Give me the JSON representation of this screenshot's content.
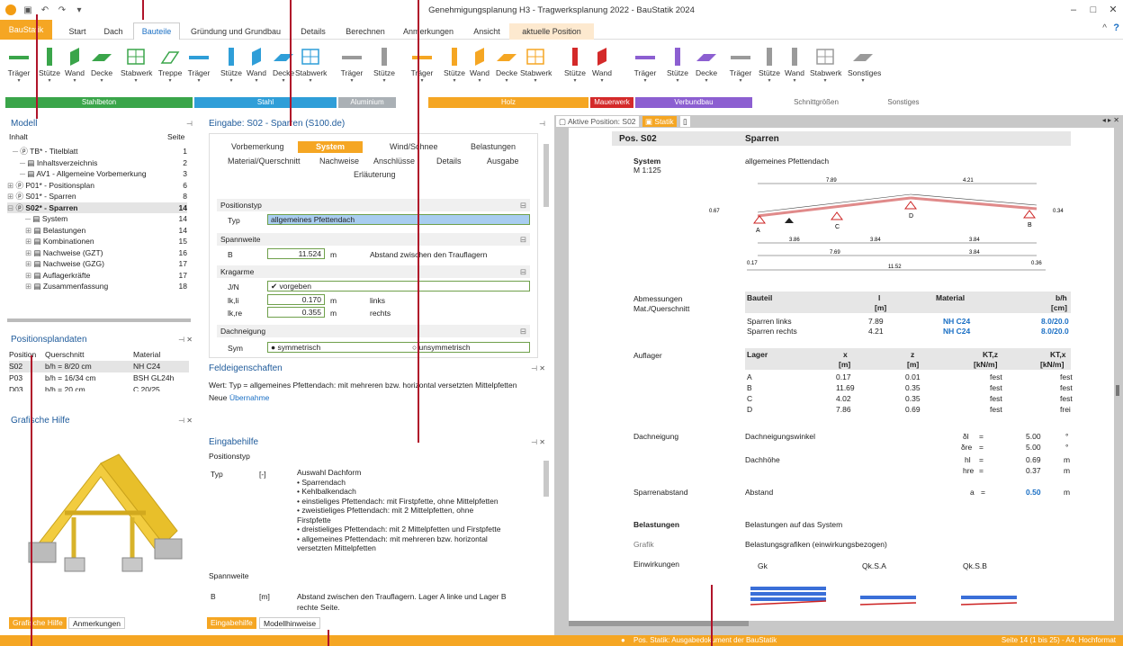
{
  "window": {
    "title": "Genehmigungsplanung H3 - Tragwerksplanung 2022 - BauStatik 2024"
  },
  "tabs": [
    {
      "label": "BauStatik"
    },
    {
      "label": "Start"
    },
    {
      "label": "Dach"
    },
    {
      "label": "Bauteile"
    },
    {
      "label": "Gründung und Grundbau"
    },
    {
      "label": "Details"
    },
    {
      "label": "Berechnen"
    },
    {
      "label": "Anmerkungen"
    },
    {
      "label": "Ansicht"
    },
    {
      "label": "aktuelle Position"
    }
  ],
  "ribbon": {
    "labels": [
      "Träger",
      "Stütze",
      "Wand",
      "Decke",
      "Stabwerk",
      "Treppe",
      "Träger",
      "Stütze",
      "Wand",
      "Decke",
      "Stabwerk",
      "Träger",
      "Stütze",
      "Träger",
      "Stütze",
      "Wand",
      "Decke",
      "Stabwerk",
      "Stütze",
      "Wand",
      "Träger",
      "Stütze",
      "Decke",
      "Träger",
      "Stütze",
      "Wand",
      "Stabwerk",
      "Sonstiges"
    ],
    "groups": [
      "Stahlbeton",
      "Stahl",
      "Aluminium",
      "Holz",
      "Mauerwerk",
      "Verbundbau",
      "Schnittgrößen",
      "Sonstiges"
    ]
  },
  "modell": {
    "title": "Modell",
    "col_content": "Inhalt",
    "col_page": "Seite",
    "items": [
      {
        "label": "TB* - Titelblatt",
        "page": "1"
      },
      {
        "label": "Inhaltsverzeichnis",
        "page": "2"
      },
      {
        "label": "AV1 - Allgemeine Vorbemerkung",
        "page": "3"
      },
      {
        "label": "P01* - Positionsplan",
        "page": "6"
      },
      {
        "label": "S01* - Sparren",
        "page": "8"
      },
      {
        "label": "S02* - Sparren",
        "page": "14"
      },
      {
        "label": "System",
        "page": "14"
      },
      {
        "label": "Belastungen",
        "page": "14"
      },
      {
        "label": "Kombinationen",
        "page": "15"
      },
      {
        "label": "Nachweise (GZT)",
        "page": "16"
      },
      {
        "label": "Nachweise (GZG)",
        "page": "17"
      },
      {
        "label": "Auflagerkräfte",
        "page": "17"
      },
      {
        "label": "Zusammenfassung",
        "page": "18"
      }
    ]
  },
  "positionsplan": {
    "title": "Positionsplandaten",
    "headers": [
      "Position",
      "Querschnitt",
      "Material"
    ],
    "rows": [
      [
        "S02",
        "b/h = 8/20 cm",
        "NH C24"
      ],
      [
        "P03",
        "b/h = 16/34 cm",
        "BSH GL24h"
      ],
      [
        "D03",
        "b/h = 20 cm",
        "C 20/25"
      ]
    ]
  },
  "grafische_hilfe": {
    "title": "Grafische Hilfe",
    "tab1": "Grafische Hilfe",
    "tab2": "Anmerkungen"
  },
  "eingabe": {
    "title": "Eingabe: S02 - Sparren (S100.de)",
    "tabs": [
      "Vorbemerkung",
      "System",
      "Wind/Schnee",
      "Belastungen",
      "Material/Querschnitt",
      "Nachweise",
      "Anschlüsse",
      "Details",
      "Ausgabe",
      "Erläuterung"
    ],
    "sec_postyp": "Positionstyp",
    "typ_label": "Typ",
    "typ_value": "allgemeines Pfettendach",
    "sec_spannweite": "Spannweite",
    "b_label": "B",
    "b_value": "11.524",
    "b_unit": "m",
    "b_desc": "Abstand zwischen den Trauflagern",
    "sec_kragarme": "Kragarme",
    "jn_label": "J/N",
    "jn_value": "vorgeben",
    "lkli_label": "lk,li",
    "lkli_value": "0.170",
    "lkli_unit": "m",
    "lkli_desc": "links",
    "lkre_label": "lk,re",
    "lkre_value": "0.355",
    "lkre_unit": "m",
    "lkre_desc": "rechts",
    "sec_dachneigung": "Dachneigung",
    "sym_label": "Sym",
    "sym_opt1": "symmetrisch",
    "sym_opt2": "unsymmetrisch"
  },
  "feld": {
    "title": "Feldeigenschaften",
    "text": "Wert: Typ = allgemeines Pfettendach: mit mehreren bzw. horizontal versetzten Mittelpfetten",
    "neue": "Neue",
    "link": "Übernahme"
  },
  "eingabehilfe": {
    "title": "Eingabehilfe",
    "section": "Positionstyp",
    "typ": "Typ",
    "unit": "[-]",
    "lines": [
      "Auswahl Dachform",
      "• Sparrendach",
      "• Kehlbalkendach",
      "• einstieliges Pfettendach: mit Firstpfette, ohne Mittelpfetten",
      "• zweistieliges Pfettendach: mit 2 Mittelpfetten, ohne",
      "Firstpfette",
      "• dreistieliges Pfettendach: mit 2 Mittelpfetten und Firstpfette",
      "• allgemeines Pfettendach: mit mehreren bzw. horizontal",
      "versetzten Mittelpfetten"
    ],
    "section2": "Spannweite",
    "b": "B",
    "b_unit": "[m]",
    "b_text1": "Abstand zwischen den Trauflagern. Lager A linke und Lager B",
    "b_text2": "rechte Seite.",
    "tab1": "Eingabehilfe",
    "tab2": "Modellhinweise"
  },
  "doc": {
    "tab1": "Aktive Position: S02",
    "tab2": "Statik",
    "pos": "Pos. S02",
    "pos_name": "Sparren",
    "system": "System",
    "scale": "M 1:125",
    "system_val": "allgemeines Pfettendach",
    "dims": [
      "7.89",
      "4.21",
      "3.86",
      "3.84",
      "3.84",
      "7.69",
      "3.84",
      "0.17",
      "11.52",
      "0.36",
      "0.34",
      "0.67"
    ],
    "supports": [
      "A",
      "C",
      "D",
      "B"
    ],
    "abm": "Abmessungen",
    "matq": "Mat./Querschnitt",
    "h_bauteil": "Bauteil",
    "h_l": "l",
    "h_lunit": "[m]",
    "h_mat": "Material",
    "h_bh": "b/h",
    "h_bhunit": "[cm]",
    "rows_mat": [
      [
        "Sparren links",
        "7.89",
        "NH C24",
        "8.0/20.0"
      ],
      [
        "Sparren rechts",
        "4.21",
        "NH C24",
        "8.0/20.0"
      ]
    ],
    "auflager": "Auflager",
    "h_lager": "Lager",
    "h_x": "x",
    "h_z": "z",
    "h_ktz": "KT,z",
    "h_ktx": "KT,x",
    "h_xu": "[m]",
    "h_zu": "[m]",
    "h_ktzu": "[kN/m]",
    "h_ktxu": "[kN/m]",
    "rows_lager": [
      [
        "A",
        "0.17",
        "0.01",
        "fest",
        "fest"
      ],
      [
        "B",
        "11.69",
        "0.35",
        "fest",
        "fest"
      ],
      [
        "C",
        "4.02",
        "0.35",
        "fest",
        "fest"
      ],
      [
        "D",
        "7.86",
        "0.69",
        "fest",
        "frei"
      ]
    ],
    "dachneigung": "Dachneigung",
    "dn_winkel": "Dachneigungswinkel",
    "dl": "δl",
    "dr": "δre",
    "dl_val": "5.00",
    "dr_val": "5.00",
    "deg": "°",
    "dachhoehe": "Dachhöhe",
    "hl": "hl",
    "hr": "hre",
    "hl_val": "0.69",
    "hr_val": "0.37",
    "m": "m",
    "eq": "=",
    "sparrenabstand": "Sparrenabstand",
    "abstand": "Abstand",
    "a": "a",
    "a_val": "0.50",
    "belastungen": "Belastungen",
    "bel_text": "Belastungen auf das System",
    "grafik": "Grafik",
    "grafik_text": "Belastungsgrafiken (einwirkungsbezogen)",
    "einwirkungen": "Einwirkungen",
    "gk": "Gk",
    "qksa": "Qk.S.A",
    "qksb": "Qk.S.B"
  },
  "status": {
    "left": "Pos. Statik: Ausgabedokument der BauStatik",
    "right": "Seite 14 (1 bis 25) - A4, Hochformat"
  },
  "colors": {
    "accent": "#f5a623",
    "blue": "#1a6fc4",
    "green": "#6fa04b"
  }
}
